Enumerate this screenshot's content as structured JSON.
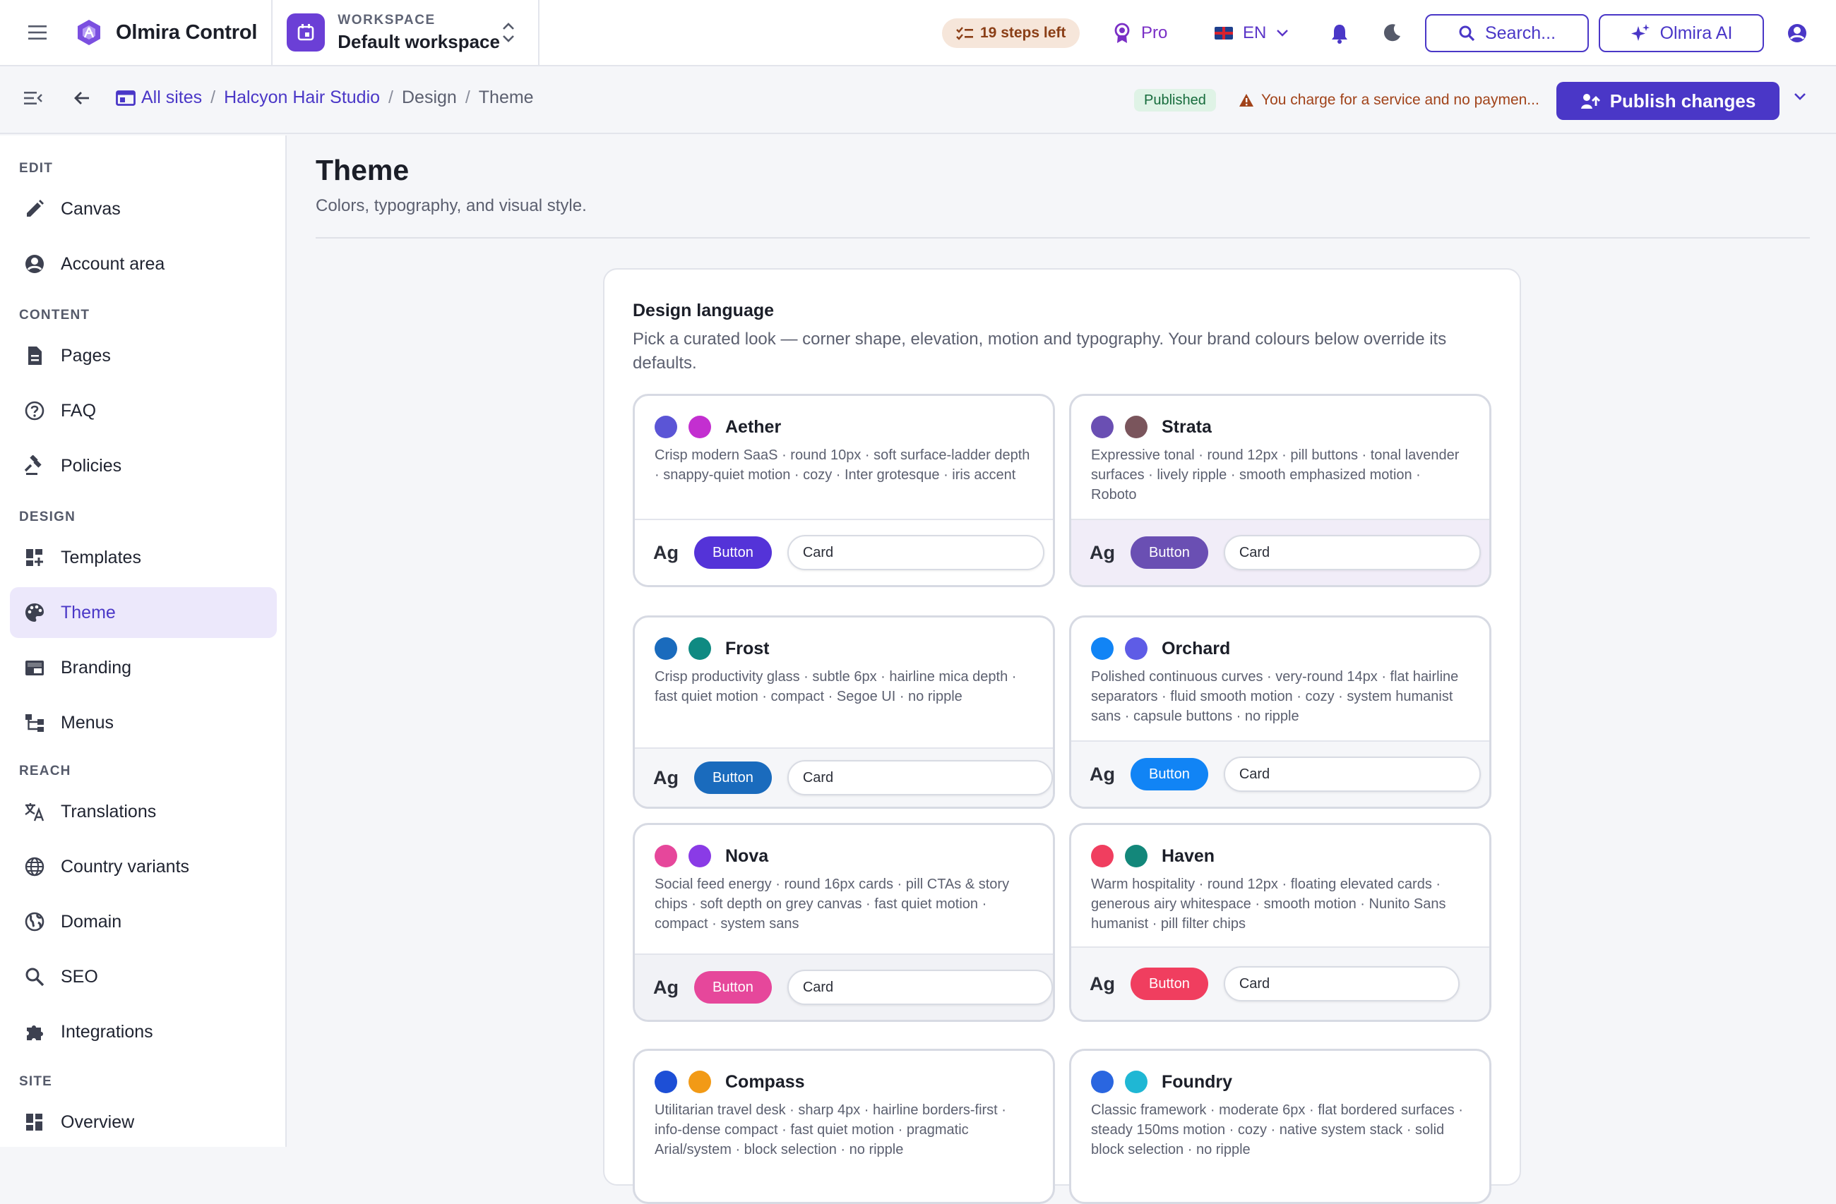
{
  "app": {
    "name": "Olmira Control"
  },
  "workspace": {
    "label": "WORKSPACE",
    "name": "Default workspace"
  },
  "topbar": {
    "steps_left": "19 steps left",
    "plan": "Pro",
    "language": "EN",
    "search_label": "Search...",
    "ai_label": "Olmira AI"
  },
  "breadcrumb": {
    "items": [
      "All sites",
      "Halcyon Hair Studio",
      "Design",
      "Theme"
    ]
  },
  "status": {
    "published": "Published",
    "warning": "You charge for a service and no paymen...",
    "publish_label": "Publish changes"
  },
  "sidebar": {
    "sections": [
      {
        "title": "EDIT",
        "items": [
          {
            "label": "Canvas",
            "icon": "pencil-icon"
          },
          {
            "label": "Account area",
            "icon": "account-circle-icon"
          }
        ]
      },
      {
        "title": "CONTENT",
        "items": [
          {
            "label": "Pages",
            "icon": "document-icon"
          },
          {
            "label": "FAQ",
            "icon": "help-circle-icon"
          },
          {
            "label": "Policies",
            "icon": "gavel-icon"
          }
        ]
      },
      {
        "title": "DESIGN",
        "items": [
          {
            "label": "Templates",
            "icon": "dashboard-plus-icon"
          },
          {
            "label": "Theme",
            "icon": "palette-icon",
            "active": true
          },
          {
            "label": "Branding",
            "icon": "branding-icon"
          },
          {
            "label": "Menus",
            "icon": "menu-tree-icon"
          }
        ]
      },
      {
        "title": "REACH",
        "items": [
          {
            "label": "Translations",
            "icon": "translate-icon"
          },
          {
            "label": "Country variants",
            "icon": "globe-icon"
          },
          {
            "label": "Domain",
            "icon": "domain-globe-icon"
          },
          {
            "label": "SEO",
            "icon": "search-icon"
          },
          {
            "label": "Integrations",
            "icon": "puzzle-icon"
          }
        ]
      },
      {
        "title": "SITE",
        "items": [
          {
            "label": "Overview",
            "icon": "dashboard-icon"
          }
        ]
      }
    ]
  },
  "page": {
    "title": "Theme",
    "subtitle": "Colors, typography, and visual style."
  },
  "design_language": {
    "title": "Design language",
    "description": "Pick a curated look — corner shape, elevation, motion and typography. Your brand colours below override its defaults.",
    "preview_glyph": "Ag",
    "preview_button": "Button",
    "preview_card": "Card",
    "themes": [
      {
        "name": "Aether",
        "colors": [
          "#5b55d6",
          "#c32fd0"
        ],
        "button_color": "#5433d8",
        "desc": "Crisp modern SaaS · round 10px · soft surface-ladder depth · snappy-quiet motion · cozy · Inter grotesque · iris accent"
      },
      {
        "name": "Strata",
        "colors": [
          "#6a4fb3",
          "#7a555c"
        ],
        "button_color": "#6a4fb3",
        "desc": "Expressive tonal · round 12px · pill buttons · tonal lavender surfaces · lively ripple · smooth emphasized motion · Roboto"
      },
      {
        "name": "Frost",
        "colors": [
          "#1a6bbd",
          "#0f8a82"
        ],
        "button_color": "#1a6bbd",
        "desc": "Crisp productivity glass · subtle 6px · hairline mica depth · fast quiet motion · compact · Segoe UI · no ripple"
      },
      {
        "name": "Orchard",
        "colors": [
          "#1184f5",
          "#5e5ce6"
        ],
        "button_color": "#1184f5",
        "desc": "Polished continuous curves · very-round 14px · flat hairline separators · fluid smooth motion · cozy · system humanist sans · capsule buttons · no ripple"
      },
      {
        "name": "Nova",
        "colors": [
          "#e6479b",
          "#8a3be6"
        ],
        "button_color": "#e6479b",
        "desc": "Social feed energy · round 16px cards · pill CTAs & story chips · soft depth on grey canvas · fast quiet motion · compact · system sans"
      },
      {
        "name": "Haven",
        "colors": [
          "#f03e5f",
          "#13877a"
        ],
        "button_color": "#f03e5f",
        "desc": "Warm hospitality · round 12px · floating elevated cards · generous airy whitespace · smooth motion · Nunito Sans humanist · pill filter chips"
      },
      {
        "name": "Compass",
        "colors": [
          "#1d4fd6",
          "#f29a16"
        ],
        "button_color": "#1d4fd6",
        "desc": "Utilitarian travel desk · sharp 4px · hairline borders-first · info-dense compact · fast quiet motion · pragmatic Arial/system · block selection · no ripple"
      },
      {
        "name": "Foundry",
        "colors": [
          "#2a66e0",
          "#1fb7d4"
        ],
        "button_color": "#2a66e0",
        "desc": "Classic framework · moderate 6px · flat bordered surfaces · steady 150ms motion · cozy · native system stack · solid block selection · no ripple"
      }
    ]
  }
}
